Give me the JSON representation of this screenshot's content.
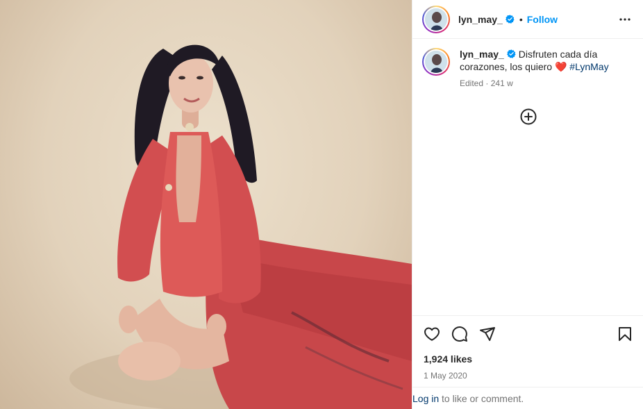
{
  "post": {
    "username": "lyn_may_",
    "verified": true,
    "follow_label": "Follow",
    "separator": "•",
    "more_icon": "more-horizontal-icon",
    "caption_text": "Disfruten cada día corazones, los quiero ",
    "caption_emoji": "❤️",
    "caption_hashtag": "#LynMay",
    "edited_label": "Edited",
    "meta_separator": "·",
    "age": "241 w",
    "likes": "1,924 likes",
    "date": "1 May 2020",
    "comment_login_link": "Log in",
    "comment_prompt": " to like or comment."
  },
  "icons": {
    "like": "heart-icon",
    "comment": "comment-icon",
    "share": "send-icon",
    "save": "bookmark-icon",
    "load_more": "plus-circle-icon"
  },
  "colors": {
    "accent": "#0095f6",
    "hashtag": "#00376b",
    "muted": "#737373",
    "heart": "#ed4956",
    "border": "#efefef"
  }
}
